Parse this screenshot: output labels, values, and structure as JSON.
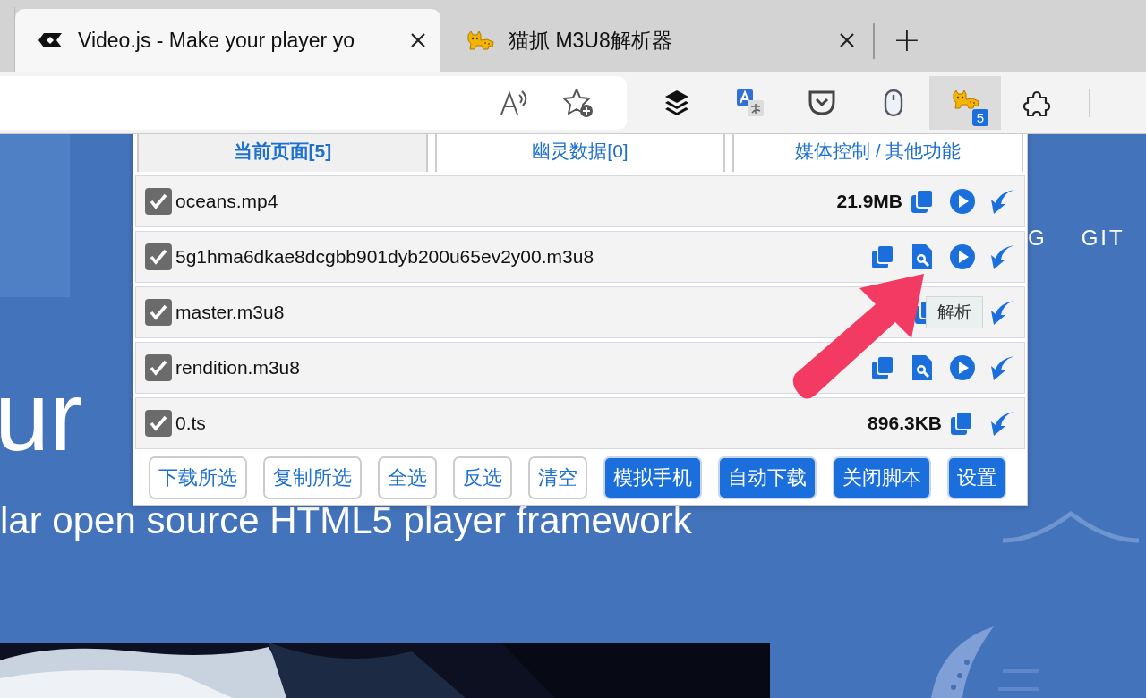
{
  "browser_tabs": [
    {
      "title": "Video.js - Make your player yo",
      "selected": true
    },
    {
      "title": "猫抓 M3U8解析器",
      "selected": false
    }
  ],
  "new_tab": "+",
  "toolbar": {
    "extensions": [
      {
        "kind": "layers"
      },
      {
        "kind": "translate"
      },
      {
        "kind": "pocket"
      },
      {
        "kind": "mouse"
      },
      {
        "kind": "cat",
        "badge": "5",
        "selected": true
      },
      {
        "kind": "puzzle"
      }
    ]
  },
  "page": {
    "nav": [
      "G",
      "GIT"
    ],
    "headline": "ur",
    "tagline": "lar open source HTML5 player framework"
  },
  "popup": {
    "tabs": [
      {
        "label": "当前页面[5]",
        "selected": true
      },
      {
        "label": "幽灵数据[0]",
        "selected": false
      },
      {
        "label": "媒体控制 / 其他功能",
        "selected": false
      }
    ],
    "rows": [
      {
        "checked": true,
        "name": "oceans.mp4",
        "size": "21.9MB",
        "actions": [
          {
            "kind": "copy"
          },
          {
            "kind": "play"
          },
          {
            "kind": "download"
          }
        ]
      },
      {
        "checked": true,
        "name": "5g1hma6dkae8dcgbb901dyb200u65ev2y00.m3u8",
        "actions": [
          {
            "kind": "copy"
          },
          {
            "kind": "parse"
          },
          {
            "kind": "play"
          },
          {
            "kind": "download"
          }
        ]
      },
      {
        "checked": true,
        "name": "master.m3u8",
        "actions": [
          {
            "kind": "copy"
          },
          {
            "kind": "download"
          }
        ],
        "tooltip": "解析"
      },
      {
        "checked": true,
        "name": "rendition.m3u8",
        "actions": [
          {
            "kind": "copy"
          },
          {
            "kind": "parse"
          },
          {
            "kind": "play"
          },
          {
            "kind": "download"
          }
        ]
      },
      {
        "checked": true,
        "name": "0.ts",
        "size": "896.3KB",
        "actions": [
          {
            "kind": "copy"
          },
          {
            "kind": "download"
          }
        ]
      }
    ],
    "buttons": [
      {
        "label": "下载所选",
        "kind": "outline"
      },
      {
        "label": "复制所选",
        "kind": "outline"
      },
      {
        "label": "全选",
        "kind": "outline"
      },
      {
        "label": "反选",
        "kind": "outline"
      },
      {
        "label": "清空",
        "kind": "outline"
      },
      {
        "label": "模拟手机",
        "kind": "filled"
      },
      {
        "label": "自动下载",
        "kind": "filled"
      },
      {
        "label": "关闭脚本",
        "kind": "filled"
      },
      {
        "label": "设置",
        "kind": "filled"
      }
    ]
  }
}
